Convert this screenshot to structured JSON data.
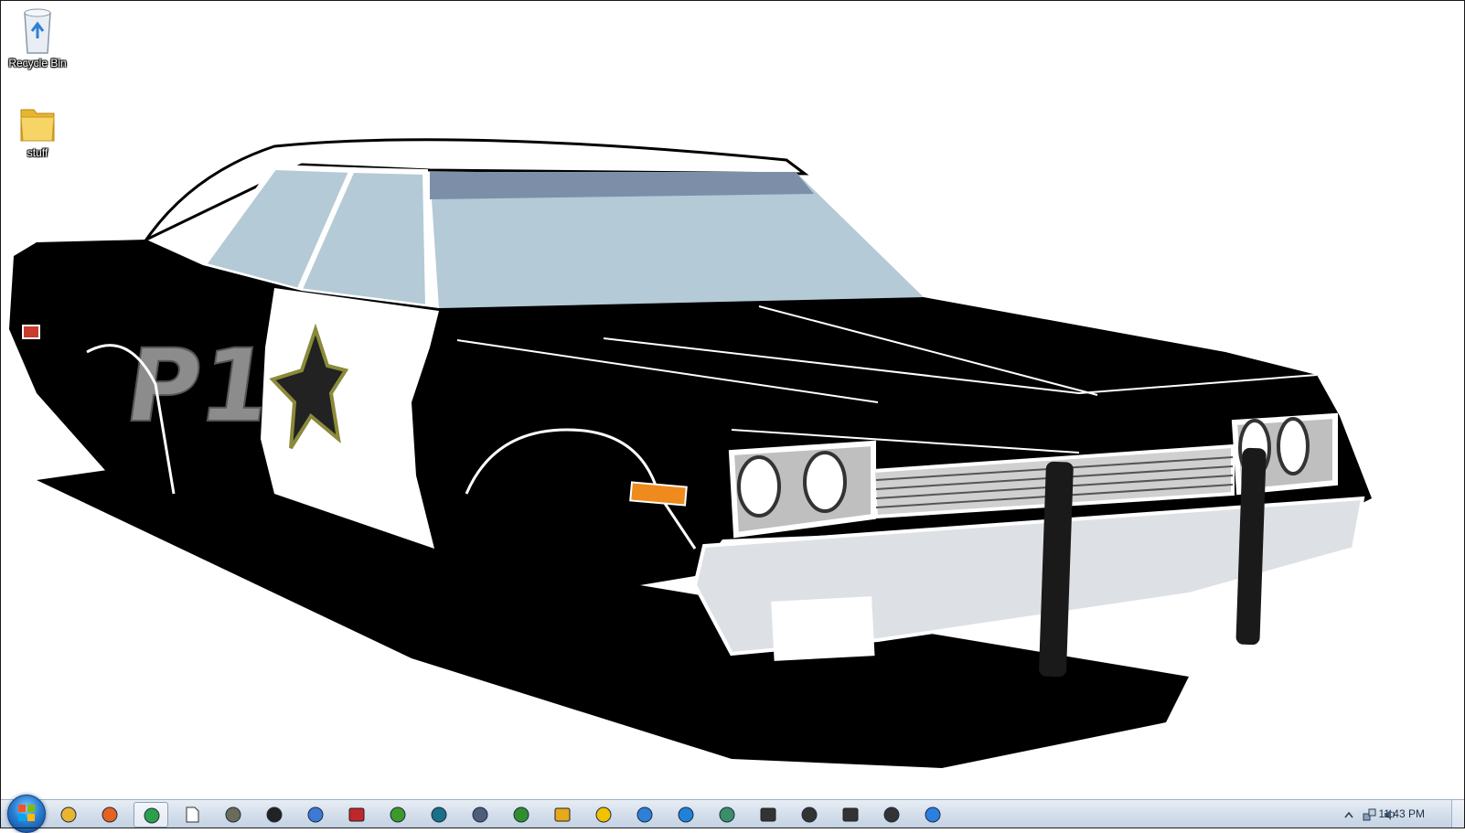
{
  "desktop": {
    "icons": [
      {
        "label": "Recycle Bin",
        "icon": "recycle-bin-icon"
      },
      {
        "label": "stuff",
        "icon": "folder-icon"
      }
    ],
    "wallpaper": {
      "door_text": "P1",
      "subject": "black-and-white police car"
    }
  },
  "taskbar": {
    "start_icon": "windows-start-orb",
    "pinned": [
      {
        "icon": "windows-explorer-icon",
        "color": "#e8b530"
      },
      {
        "icon": "firefox-icon",
        "color": "#e5621f"
      },
      {
        "icon": "chrome-icon",
        "color": "#2aa04a",
        "active": true
      },
      {
        "icon": "blank-document-icon",
        "color": "#ffffff"
      },
      {
        "icon": "gimp-icon",
        "color": "#6b6b5a"
      },
      {
        "icon": "inkscape-icon",
        "color": "#222222"
      },
      {
        "icon": "globe-icon",
        "color": "#3d7ad6"
      },
      {
        "icon": "red-speech-icon",
        "color": "#c0262b"
      },
      {
        "icon": "green-orb-icon",
        "color": "#3c9a2a"
      },
      {
        "icon": "teal-disc-icon",
        "color": "#1a6f8a"
      },
      {
        "icon": "gamepad-icon",
        "color": "#4d5d7a"
      },
      {
        "icon": "green-person-icon",
        "color": "#2f8f2f"
      },
      {
        "icon": "yellow-box-icon",
        "color": "#e7a91c"
      },
      {
        "icon": "gold-coin-icon",
        "color": "#f2c200"
      },
      {
        "icon": "blue-sphere-icon",
        "color": "#2e7fd8"
      },
      {
        "icon": "blue-search-icon",
        "color": "#1f82d8"
      },
      {
        "icon": "network-globe-icon",
        "color": "#3a8f6a"
      },
      {
        "icon": "camera-icon",
        "color": "#333333"
      },
      {
        "icon": "gear-settings-icon",
        "color": "#333333"
      },
      {
        "icon": "clapperboard-icon",
        "color": "#333333"
      },
      {
        "icon": "media-tools-icon",
        "color": "#333333"
      },
      {
        "icon": "itunes-icon",
        "color": "#2b7fe0"
      }
    ],
    "tray": {
      "icons": [
        "show-hidden-chevron-icon",
        "network-icon",
        "volume-icon"
      ],
      "clock": "11:43 PM"
    }
  }
}
